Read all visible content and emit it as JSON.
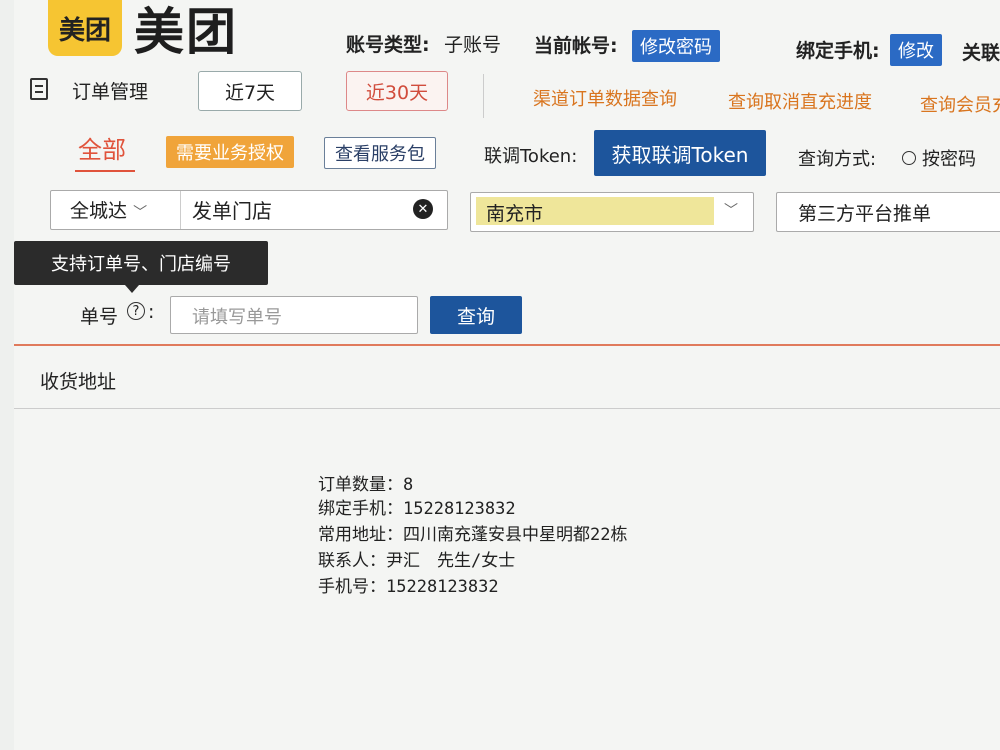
{
  "header": {
    "logo_badge": "美团",
    "logo_word": "美团",
    "account_type_label": "账号类型:",
    "account_type_value": "子账号",
    "current_account_label": "当前帐号:",
    "change_password": "修改密码",
    "bound_phone_label": "绑定手机:",
    "modify": "修改",
    "related_truncated": "关联"
  },
  "nav": {
    "title": "订单管理",
    "range_7": "近7天",
    "range_30": "近30天",
    "link_channel": "渠道订单数据查询",
    "link_cancel": "查询取消直充进度",
    "link_member": "查询会员充"
  },
  "toolbar": {
    "tab_all": "全部",
    "need_auth": "需要业务授权",
    "view_package": "查看服务包",
    "token_label": "联调Token:",
    "get_token": "获取联调Token",
    "query_mode_label": "查询方式:",
    "by_password": "按密码"
  },
  "filters": {
    "city_prefix": "全城达",
    "store_value": "发单门店",
    "region_value": "南充市",
    "source_value": "第三方平台推单"
  },
  "tooltip": "支持订单号、门店编号",
  "search": {
    "label": "单号",
    "colon": ":",
    "placeholder": "请填写单号",
    "button": "查询"
  },
  "list": {
    "header": "收货地址"
  },
  "info": {
    "order_count": "订单数量：8",
    "bound_phone": "绑定手机：15228123832",
    "address": "常用地址：四川南充蓬安县中星明都22栋",
    "contact": "联系人：尹汇　先生/女士",
    "phone": "手机号：15228123832"
  }
}
